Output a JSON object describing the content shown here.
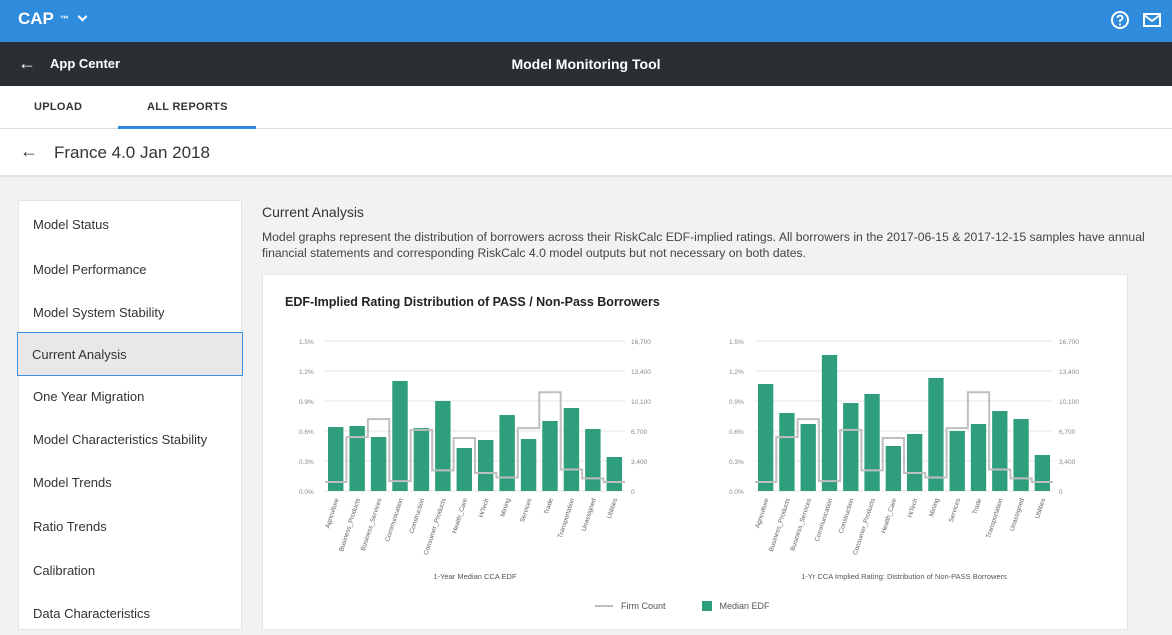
{
  "topbar": {
    "brand": "CAP",
    "brand_tm": "™",
    "icons": [
      "help-icon",
      "mail-icon"
    ]
  },
  "appbar": {
    "back_label": "App Center",
    "title": "Model Monitoring Tool"
  },
  "tabs": [
    {
      "label": "UPLOAD"
    },
    {
      "label": "ALL REPORTS",
      "active": true
    }
  ],
  "report": {
    "title": "France 4.0 Jan 2018"
  },
  "sidebar": {
    "items": [
      {
        "label": "Model Status"
      },
      {
        "label": "Model Performance"
      },
      {
        "label": "Model System Stability"
      },
      {
        "label": "Current Analysis",
        "active": true
      },
      {
        "label": "One Year Migration"
      },
      {
        "label": "Model Characteristics Stability"
      },
      {
        "label": "Model Trends"
      },
      {
        "label": "Ratio Trends"
      },
      {
        "label": "Calibration"
      },
      {
        "label": "Data Characteristics"
      }
    ]
  },
  "main": {
    "title": "Current Analysis",
    "description": "Model graphs represent the distribution of borrowers across their RiskCalc EDF-implied ratings. All borrowers in the 2017-06-15 & 2017-12-15 samples have annual financial statements and corresponding RiskCalc 4.0 model outputs but not necessary on both dates.",
    "card_title": "EDF-Implied Rating Distribution of PASS / Non-Pass Borrowers",
    "legend": {
      "firm_count": "Firm Count",
      "median_edf": "Median EDF"
    }
  },
  "colors": {
    "accent": "#2f8bdc",
    "bar": "#2e9e7c",
    "line": "#bfbfbf",
    "appbar": "#2b2f33"
  },
  "chart_data": [
    {
      "type": "bar",
      "xlabel": "1-Year Median CCA EDF",
      "categories": [
        "Agriculture",
        "Business_Products",
        "Business_Services",
        "Communication",
        "Construction",
        "Consumer_Products",
        "Health_Care",
        "HiTech",
        "Mining",
        "Services",
        "Trade",
        "Transportation",
        "Unassigned",
        "Utilities"
      ],
      "y_left_ticks": [
        "1.5%",
        "1.2%",
        "0.9%",
        "0.6%",
        "0.3%",
        "0.0%"
      ],
      "y_right_ticks": [
        "16,700",
        "13,400",
        "10,100",
        "6,700",
        "3,400",
        "0"
      ],
      "ylim": [
        0,
        1.5
      ],
      "y2lim": [
        0,
        16700
      ],
      "series": [
        {
          "name": "Median EDF",
          "values": [
            0.64,
            0.65,
            0.54,
            1.1,
            0.63,
            0.9,
            0.43,
            0.51,
            0.76,
            0.52,
            0.7,
            0.83,
            0.62,
            0.34
          ]
        },
        {
          "name": "Firm Count",
          "values": [
            1000,
            6000,
            8000,
            1100,
            6800,
            2300,
            5900,
            2000,
            1500,
            7000,
            11000,
            2400,
            1400,
            1000
          ]
        }
      ]
    },
    {
      "type": "bar",
      "xlabel": "1-Yr CCA Implied Rating: Distribution of Non-PASS Borrowers",
      "categories": [
        "Agriculture",
        "Business_Products",
        "Business_Services",
        "Communication",
        "Construction",
        "Consumer_Products",
        "Health_Care",
        "HiTech",
        "Mining",
        "Services",
        "Trade",
        "Transportation",
        "Unassigned",
        "Utilities"
      ],
      "y_left_ticks": [
        "1.5%",
        "1.2%",
        "0.9%",
        "0.6%",
        "0.3%",
        "0.0%"
      ],
      "y_right_ticks": [
        "16,700",
        "13,400",
        "10,100",
        "6,700",
        "3,400",
        "0"
      ],
      "ylim": [
        0,
        1.5
      ],
      "y2lim": [
        0,
        16700
      ],
      "series": [
        {
          "name": "Median EDF",
          "values": [
            1.07,
            0.78,
            0.67,
            1.36,
            0.88,
            0.97,
            0.45,
            0.57,
            1.13,
            0.6,
            0.67,
            0.8,
            0.72,
            0.36
          ]
        },
        {
          "name": "Firm Count",
          "values": [
            1000,
            6000,
            8000,
            1100,
            6800,
            2300,
            5900,
            2000,
            1500,
            7000,
            11000,
            2400,
            1400,
            1000
          ]
        }
      ]
    }
  ]
}
